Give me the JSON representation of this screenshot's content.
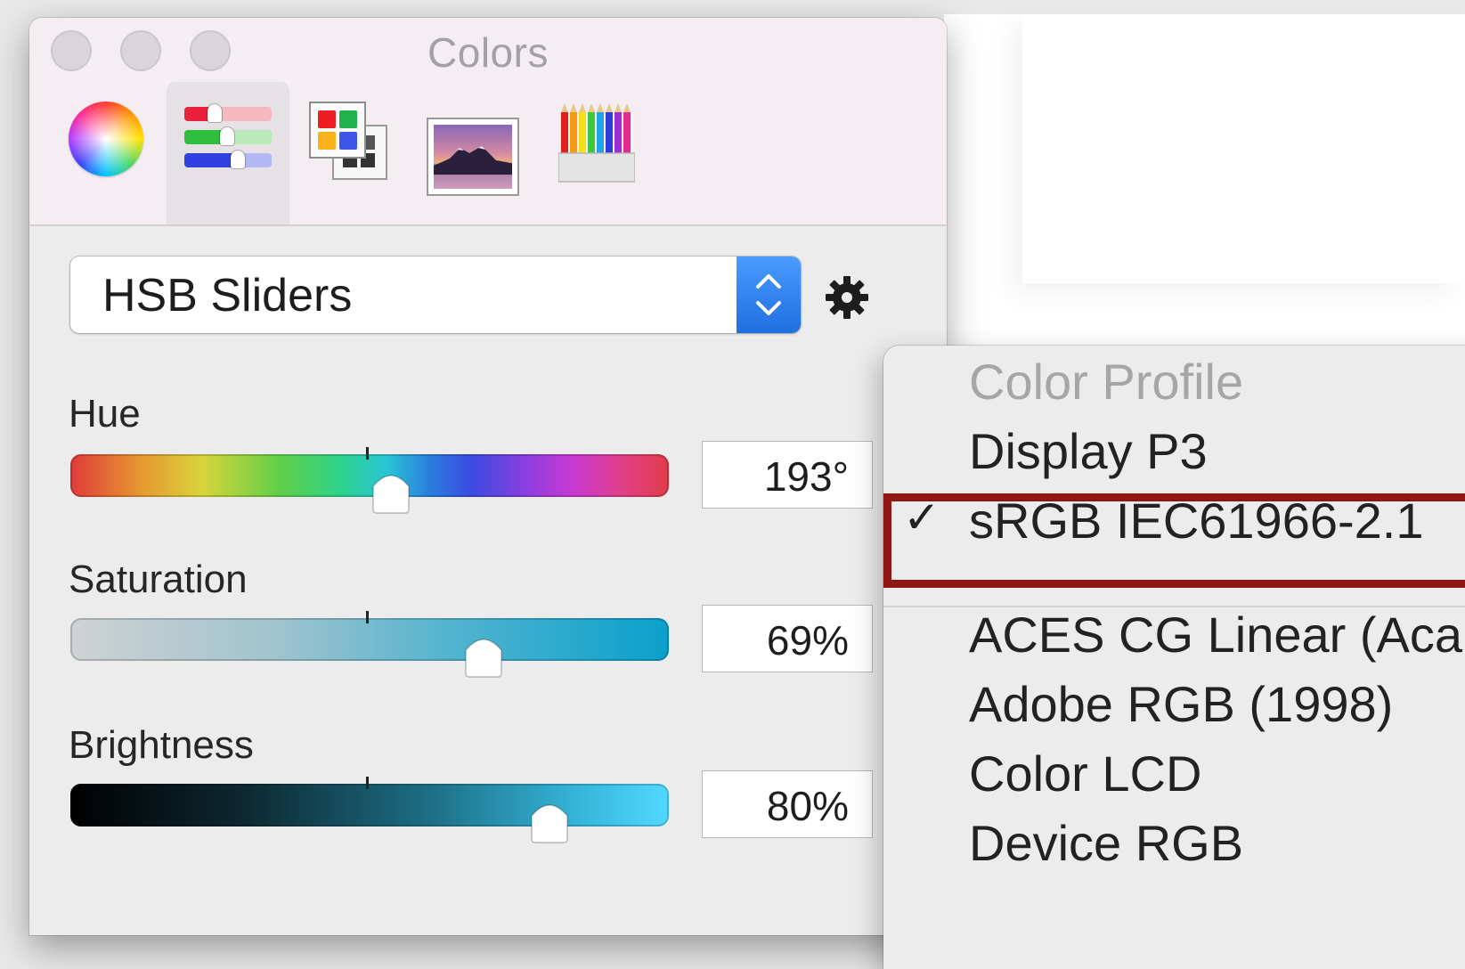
{
  "window": {
    "title": "Colors",
    "tabs": [
      {
        "name": "Color Wheel",
        "icon": "color-wheel-icon",
        "selected": false
      },
      {
        "name": "Color Sliders",
        "icon": "color-sliders-icon",
        "selected": true
      },
      {
        "name": "Color Palettes",
        "icon": "color-palettes-icon",
        "selected": false
      },
      {
        "name": "Image Palettes",
        "icon": "image-palettes-icon",
        "selected": false
      },
      {
        "name": "Pencils",
        "icon": "pencils-icon",
        "selected": false
      }
    ]
  },
  "sliders_mode": {
    "selected": "HSB Sliders",
    "gear_icon": "gear-icon"
  },
  "sliders": {
    "hue": {
      "label": "Hue",
      "value": "193°",
      "fraction": 0.535
    },
    "saturation": {
      "label": "Saturation",
      "value": "69%",
      "fraction": 0.69
    },
    "brightness": {
      "label": "Brightness",
      "value": "80%",
      "fraction": 0.8
    }
  },
  "menu": {
    "header": "Color Profile",
    "items": [
      {
        "label": "Display P3",
        "checked": false
      },
      {
        "label": "sRGB IEC61966-2.1",
        "checked": true
      }
    ],
    "items2": [
      {
        "label": "ACES CG Linear (Aca"
      },
      {
        "label": "Adobe RGB (1998)"
      },
      {
        "label": "Color LCD"
      },
      {
        "label": "Device RGB"
      }
    ],
    "check_glyph": "✓",
    "highlight_color": "#8e1713"
  },
  "colors": {
    "accent": "#1f6fe0",
    "current_color": "#1aa3cc"
  }
}
